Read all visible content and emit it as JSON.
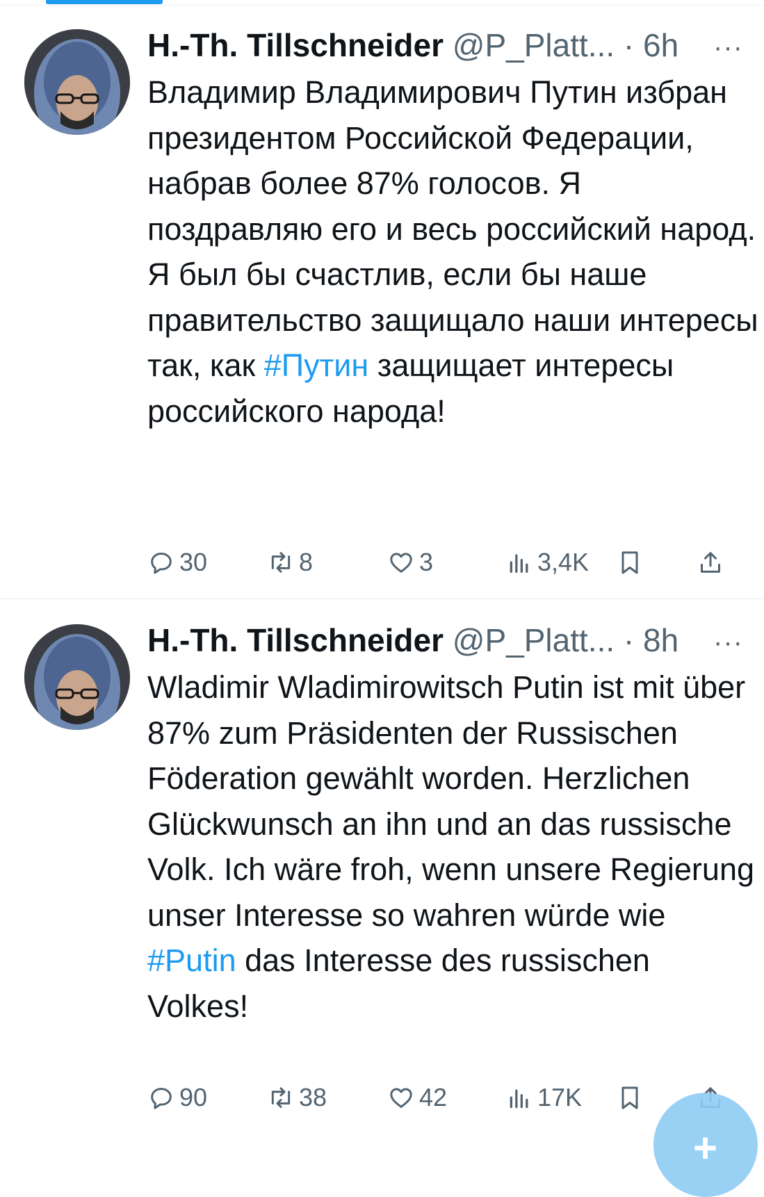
{
  "colors": {
    "accent": "#1d9bf0",
    "muted": "#536471",
    "text": "#0f1419"
  },
  "tweets": [
    {
      "display_name": "H.-Th. Tillschneider",
      "handle": "@P_Platt...",
      "separator": "·",
      "time": "6h",
      "more": "···",
      "text_before": "Владимир Владимирович Путин избран президентом Российской Федерации, набрав более 87% голосов. Я поздравляю его и весь российский народ. Я был бы счастлив, если бы наше правительство защищало наши интересы так, как ",
      "hashtag": "#Путин",
      "text_after": " защищает интересы российского народа!",
      "replies": "30",
      "reposts": "8",
      "likes": "3",
      "views": "3,4K"
    },
    {
      "display_name": "H.-Th. Tillschneider",
      "handle": "@P_Platt...",
      "separator": "·",
      "time": "8h",
      "more": "···",
      "text_before": "Wladimir Wladimirowitsch Putin ist mit über 87% zum Präsidenten der Russischen Föderation gewählt worden. Herzlichen Glückwunsch an ihn und an das russische Volk. Ich wäre froh, wenn unsere Regierung unser Interesse so wahren würde wie ",
      "hashtag": "#Putin",
      "text_after": " das Interesse des russischen Volkes!",
      "replies": "90",
      "reposts": "38",
      "likes": "42",
      "views": "17K"
    }
  ],
  "fab": {
    "label": "+"
  }
}
